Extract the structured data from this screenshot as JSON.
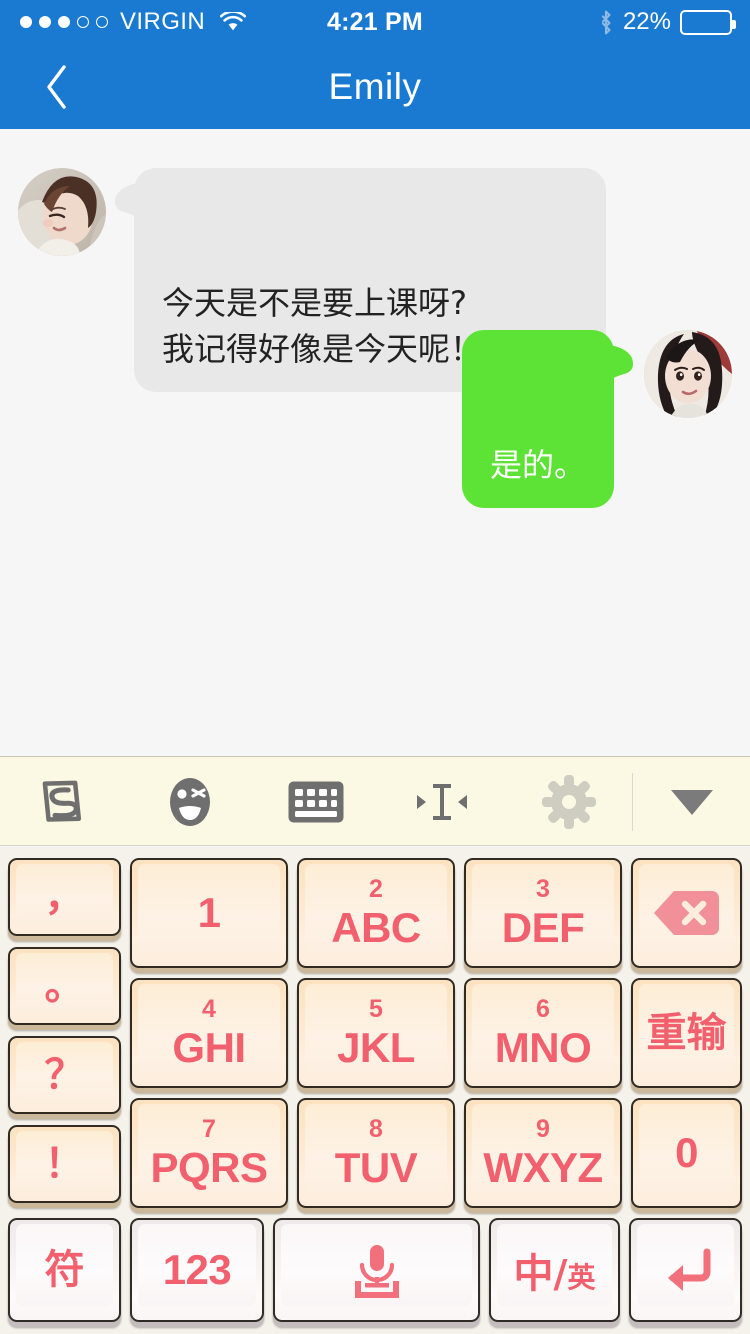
{
  "status_bar": {
    "signal_dots_filled": 3,
    "signal_dots_total": 5,
    "carrier": "VIRGIN",
    "wifi_icon": "wifi-icon",
    "time": "4:21 PM",
    "bluetooth_icon": "bluetooth-icon",
    "battery_percent": "22%",
    "battery_level": 22,
    "bg_color": "#1a7ad1"
  },
  "nav_bar": {
    "back_icon": "chevron-left-icon",
    "title": "Emily",
    "bg_color": "#1a7ad1"
  },
  "chat": {
    "background": "#f6f6f6",
    "messages": [
      {
        "direction": "incoming",
        "sender": "Emily",
        "avatar": "avatar-emily",
        "text": "今天是不是要上课呀?\n我记得好像是今天呢！！！！",
        "bubble_color": "#e8e8e8",
        "text_color": "#222222"
      },
      {
        "direction": "outgoing",
        "sender": "me",
        "avatar": "avatar-me",
        "text": "是的。",
        "bubble_color": "#5de336",
        "text_color": "#ffffff"
      }
    ]
  },
  "keyboard_toolbar": {
    "bg_color": "#fbf8e3",
    "buttons": [
      {
        "name": "sogou-logo-icon",
        "label": "S"
      },
      {
        "name": "emoji-icon",
        "label": ""
      },
      {
        "name": "keyboard-icon",
        "label": ""
      },
      {
        "name": "cursor-move-icon",
        "label": ""
      },
      {
        "name": "gear-icon",
        "label": ""
      }
    ],
    "collapse": {
      "name": "chevron-down-icon",
      "label": ""
    }
  },
  "keypad": {
    "bg_color": "#f4f2ea",
    "key_text_color": "#f2606e",
    "punctuation_column": [
      {
        "name": "key-comma",
        "main": "，"
      },
      {
        "name": "key-period",
        "main": "。"
      },
      {
        "name": "key-question",
        "main": "？"
      },
      {
        "name": "key-exclamation",
        "main": "！"
      }
    ],
    "digit_keys": [
      {
        "name": "key-1",
        "sub": "",
        "main": "1"
      },
      {
        "name": "key-2",
        "sub": "2",
        "main": "ABC"
      },
      {
        "name": "key-3",
        "sub": "3",
        "main": "DEF"
      },
      {
        "name": "key-4",
        "sub": "4",
        "main": "GHI"
      },
      {
        "name": "key-5",
        "sub": "5",
        "main": "JKL"
      },
      {
        "name": "key-6",
        "sub": "6",
        "main": "MNO"
      },
      {
        "name": "key-7",
        "sub": "7",
        "main": "PQRS"
      },
      {
        "name": "key-8",
        "sub": "8",
        "main": "TUV"
      },
      {
        "name": "key-9",
        "sub": "9",
        "main": "WXYZ"
      }
    ],
    "right_column": [
      {
        "name": "key-backspace",
        "main": "",
        "icon": "backspace-icon"
      },
      {
        "name": "key-redo",
        "main": "重输"
      },
      {
        "name": "key-0",
        "main": "0"
      }
    ],
    "bottom_row": [
      {
        "name": "key-symbols",
        "main": "符"
      },
      {
        "name": "key-numbers",
        "main": "123"
      },
      {
        "name": "key-voice-input",
        "main": "",
        "icon": "microphone-icon"
      },
      {
        "name": "key-language-toggle",
        "main_big": "中",
        "main_sep": "/",
        "main_small": "英"
      },
      {
        "name": "key-enter",
        "main": "",
        "icon": "enter-arrow-icon"
      }
    ]
  }
}
